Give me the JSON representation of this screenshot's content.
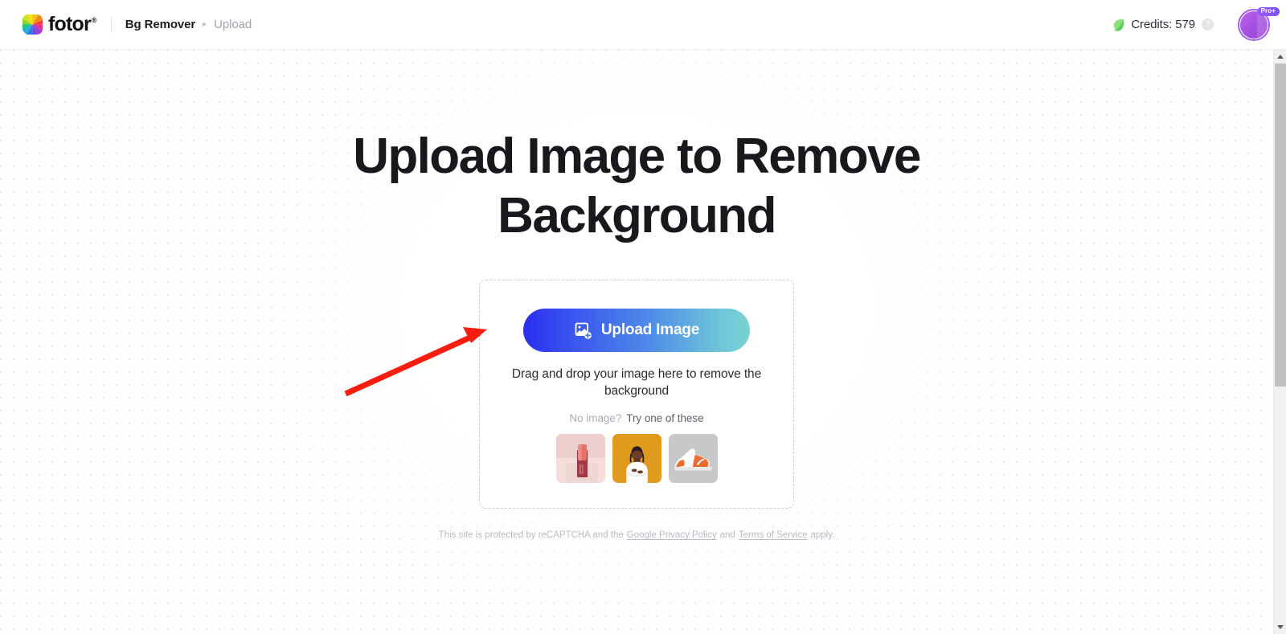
{
  "header": {
    "logo_text": "fotor",
    "logo_registered": "®",
    "breadcrumb": {
      "current": "Bg Remover",
      "separator": "▸",
      "next": "Upload"
    },
    "credits_label": "Credits: 579",
    "help_label": "?",
    "pro_badge": "Pro+"
  },
  "main": {
    "title": "Upload Image to Remove Background",
    "upload_button_label": "Upload Image",
    "drop_hint": "Drag and drop your image here to remove the background",
    "samples_prompt_dim": "No image?",
    "samples_prompt_strong": "Try one of these",
    "samples": [
      {
        "name": "cosmetic-bottle-thumbnail"
      },
      {
        "name": "woman-portrait-thumbnail"
      },
      {
        "name": "sneaker-thumbnail"
      }
    ]
  },
  "footer": {
    "prefix": "This site is protected by reCAPTCHA and the",
    "privacy_link": "Google Privacy Policy",
    "conjunction": "and",
    "terms_link": "Terms of Service",
    "suffix": "apply."
  },
  "colors": {
    "accent_start": "#2b2ef0",
    "accent_end": "#79d3cf",
    "annotation": "#fa1c0c",
    "pro_purple": "#a15cf0",
    "credits_leaf": "#7ade6a"
  }
}
